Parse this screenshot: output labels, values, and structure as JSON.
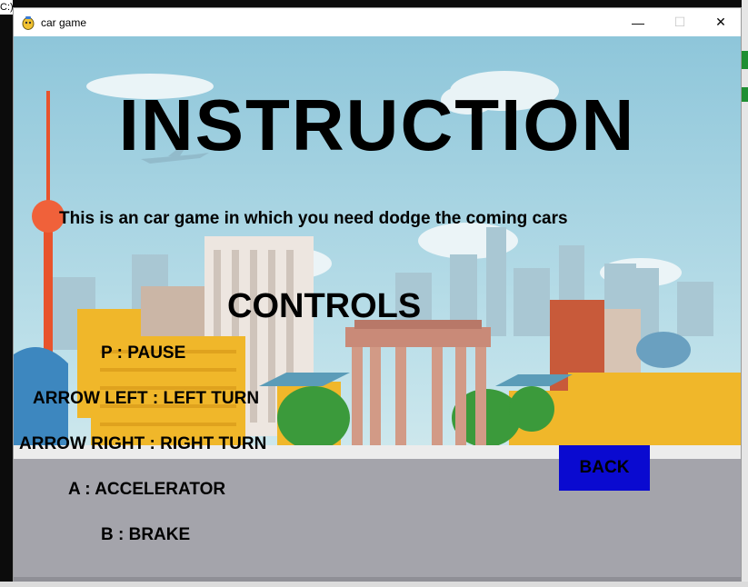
{
  "window": {
    "title": "car game",
    "minimize_glyph": "—",
    "maximize_glyph": "☐",
    "close_glyph": "✕"
  },
  "background_terminal": {
    "top_text": "C:)"
  },
  "game": {
    "heading": "INSTRUCTION",
    "description": "This is an car game in which you need dodge the coming cars",
    "controls_heading": "CONTROLS",
    "controls": [
      "P : PAUSE",
      "ARROW LEFT : LEFT TURN",
      "ARROW RIGHT : RIGHT TURN",
      "A : ACCELERATOR",
      "B : BRAKE"
    ],
    "back_label": "BACK"
  },
  "colors": {
    "sky": "#a9d6e3",
    "road": "#a4a4ab",
    "back_button": "#0a0ad0",
    "tower": "#e8532c"
  }
}
